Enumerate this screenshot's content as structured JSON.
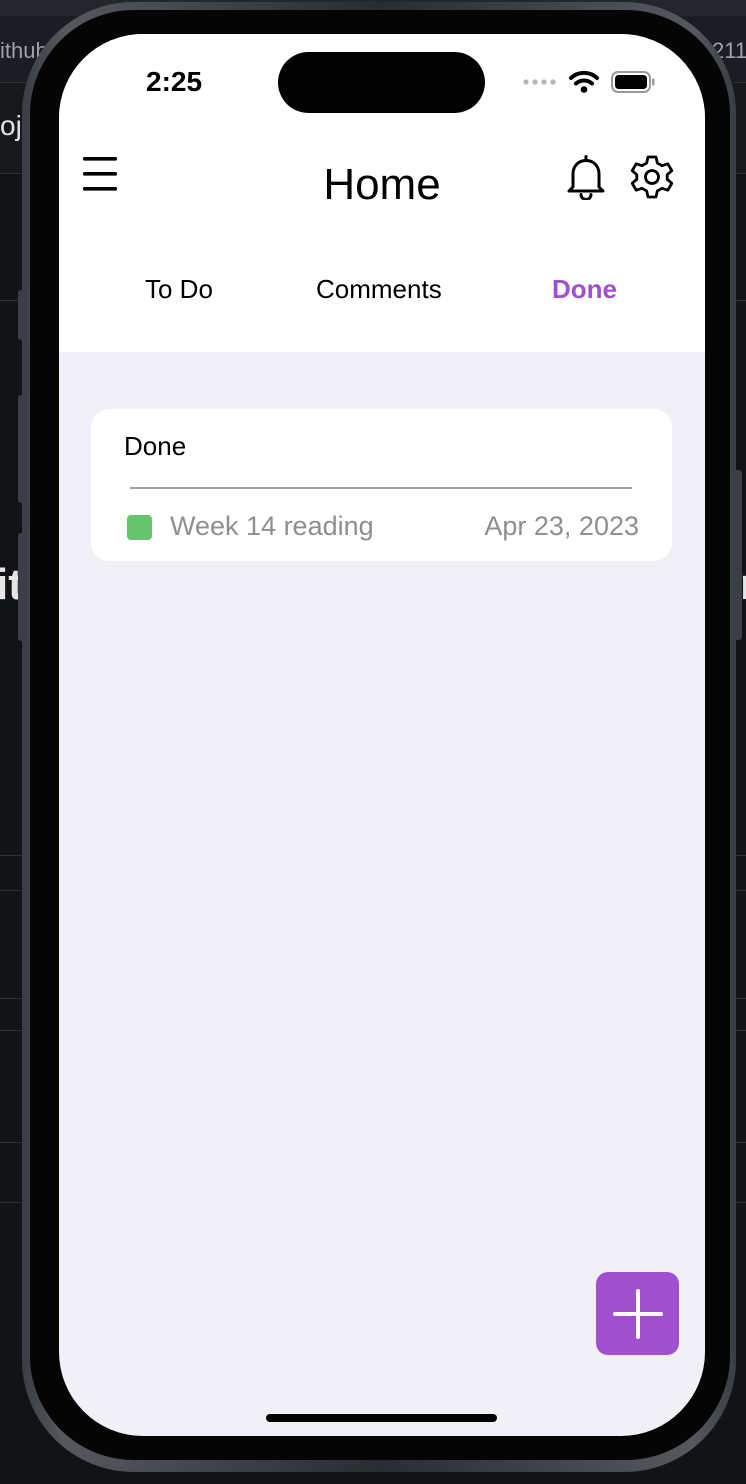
{
  "status_bar": {
    "time": "2:25",
    "icons": [
      "cellular-dots-icon",
      "wifi-icon",
      "battery-icon"
    ]
  },
  "background_window": {
    "tab_fragment_left": "ithub",
    "tab_fragment_right": "211",
    "row_fragment": "oje",
    "large_fragment_left": "it",
    "large_fragment_right": "r"
  },
  "header": {
    "title": "Home",
    "menu_icon": "hamburger-menu-icon",
    "actions": [
      "bell-icon",
      "gear-icon"
    ]
  },
  "tabs": [
    {
      "label": "To Do",
      "active": false
    },
    {
      "label": "Comments",
      "active": false
    },
    {
      "label": "Done",
      "active": true
    }
  ],
  "section": {
    "title": "Done",
    "items": [
      {
        "label": "Week 14 reading",
        "date": "Apr 23, 2023",
        "color": "#66c46d"
      }
    ]
  },
  "fab": {
    "icon": "plus-icon"
  },
  "colors": {
    "accent": "#a04fcf",
    "screen_background": "#f1f0f6",
    "item_swatch": "#66c46d",
    "muted_text": "#8e8e93"
  }
}
